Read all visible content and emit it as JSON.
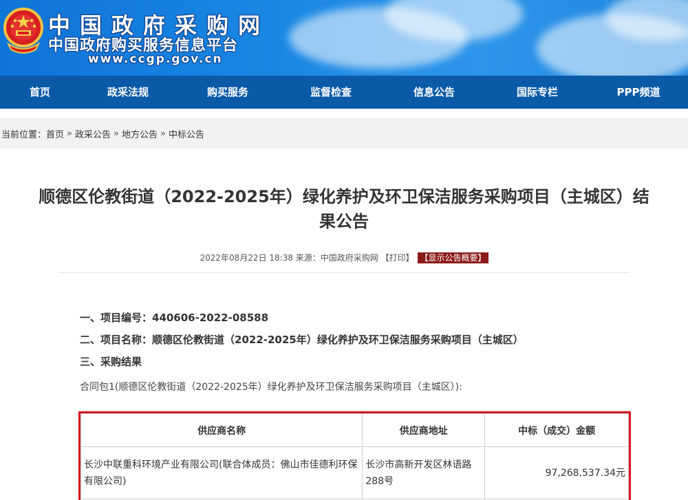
{
  "header": {
    "site_title": "中国政府采购网",
    "site_subtitle": "中国政府购买服务信息平台",
    "site_url": "www.ccgp.gov.cn",
    "emblem_icon": "national-emblem-icon"
  },
  "nav": {
    "items": [
      "首页",
      "政采法规",
      "购买服务",
      "监督检查",
      "信息公告",
      "国际专栏",
      "PPP频道"
    ]
  },
  "breadcrumb": {
    "prefix": "当前位置：",
    "items": [
      "首页",
      "政采公告",
      "地方公告",
      "中标公告"
    ],
    "separator": "»"
  },
  "article": {
    "title_line1": "顺德区伦教街道（2022-2025年）绿化养护及环卫保洁服务采购项目（主城区）结",
    "title_line2": "果公告",
    "meta_date": "2022年08月22日 18:38",
    "meta_source": "来源：中国政府采购网",
    "meta_print": "【打印】",
    "meta_summary": "【显示公告概要】",
    "item1": "一、项目编号：440606-2022-08588",
    "item2": "二、项目名称：顺德区伦教街道（2022-2025年）绿化养护及环卫保洁服务采购项目（主城区）",
    "item3": "三、采购结果",
    "package": "合同包1(顺德区伦教街道（2022-2025年）绿化养护及环卫保洁服务采购项目（主城区）):"
  },
  "table": {
    "headers": [
      "供应商名称",
      "供应商地址",
      "中标（成交）金额"
    ],
    "rows": [
      {
        "name": "长沙中联重科环境产业有限公司(联合体成员：佛山市佳德利环保有限公司)",
        "address": "长沙市高新开发区林语路288号",
        "amount": "97,268,537.34元"
      }
    ]
  }
}
